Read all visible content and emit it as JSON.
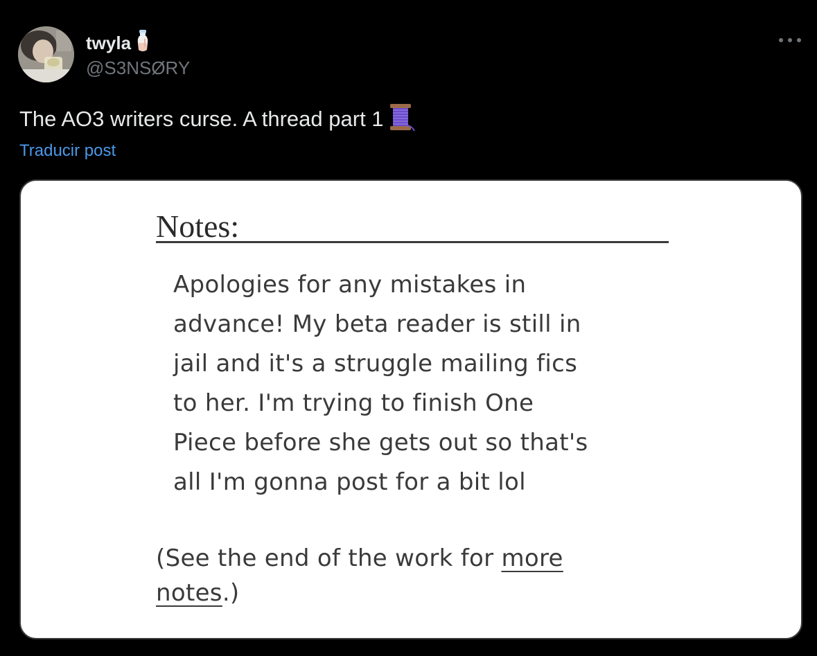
{
  "post": {
    "author": {
      "display_name": "twyla",
      "name_emoji": "milk-bottle-emoji",
      "handle": "@S3NSØRY",
      "avatar": "avatar-photo"
    },
    "more_icon": "more-horizontal-icon",
    "text": "The AO3 writers curse. A thread part 1",
    "text_emoji": "thread-spool-emoji",
    "translate_label": "Traducir post"
  },
  "media": {
    "notes_heading": "Notes:",
    "notes_body": "Apologies for any mistakes in\nadvance! My beta reader is still in\njail and it's a struggle mailing fics\nto her. I'm trying to finish One\nPiece before she gets out so that's\nall I'm gonna post for a bit lol",
    "footer_prefix": "(See the end of the work for ",
    "footer_link_1": "more",
    "footer_link_2": "notes",
    "footer_suffix": ".)"
  },
  "colors": {
    "background": "#000000",
    "primary_text": "#e7e9ea",
    "secondary_text": "#71767b",
    "link": "#4a99e9"
  }
}
